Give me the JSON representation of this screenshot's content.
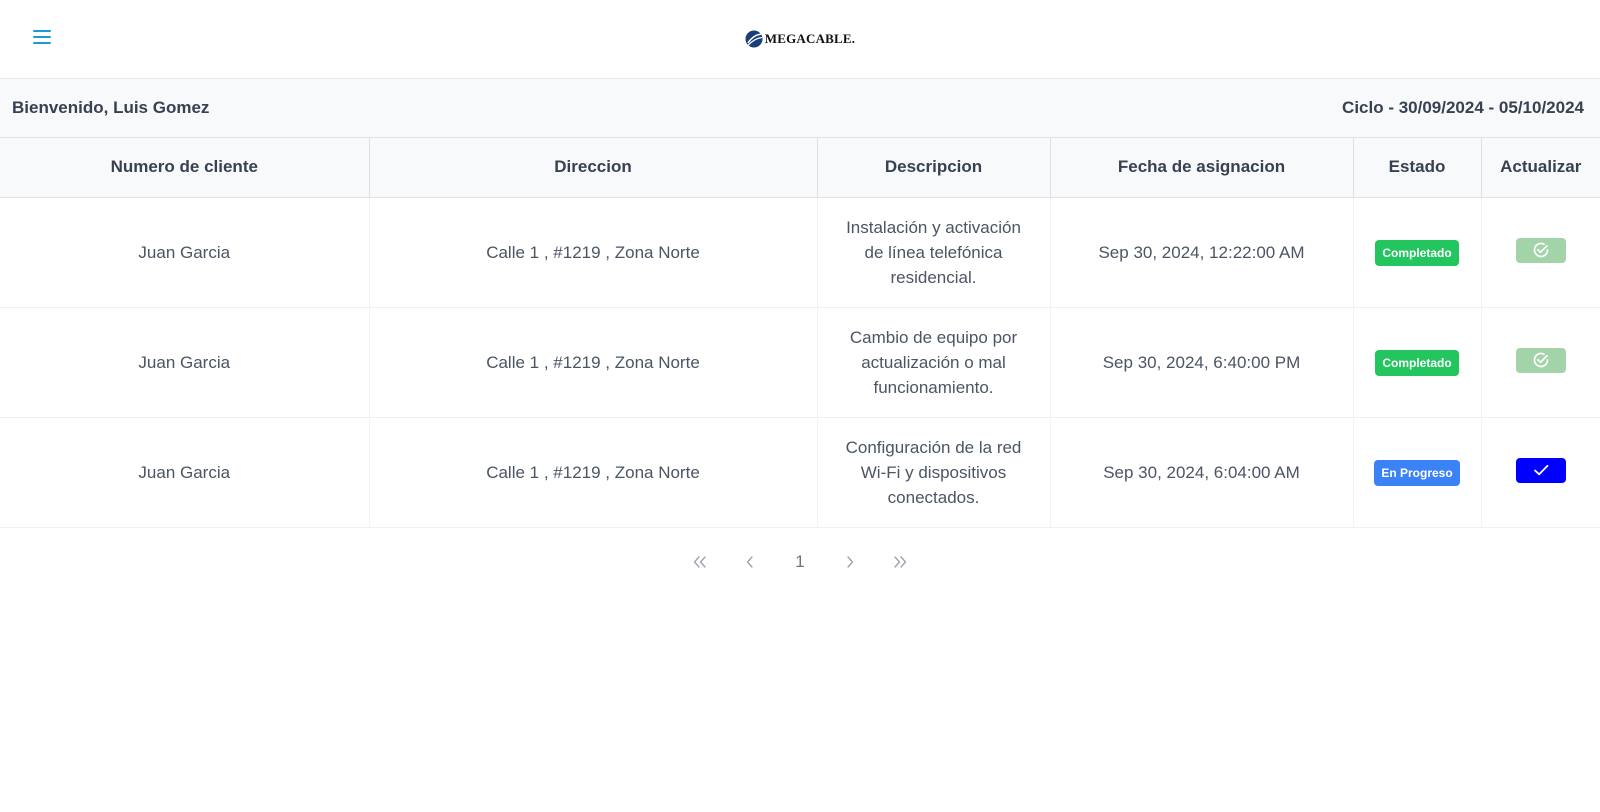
{
  "header": {
    "menu_icon": "hamburger-menu-icon",
    "logo_text": "MEGACABLE.",
    "accent_color": "#1c9bd6"
  },
  "welcome": {
    "greeting": "Bienvenido, Luis Gomez",
    "cycle": "Ciclo - 30/09/2024 - 05/10/2024"
  },
  "table": {
    "headers": [
      "Numero de cliente",
      "Direccion",
      "Descripcion",
      "Fecha de asignacion",
      "Estado",
      "Actualizar"
    ],
    "rows": [
      {
        "client": "Juan Garcia",
        "address": "Calle 1 , #1219 , Zona Norte",
        "description": "Instalación y activación de línea telefónica residencial.",
        "date": "Sep 30, 2024, 12:22:00 AM",
        "status": "Completado",
        "status_color": "#22c55e",
        "action_icon": "check-circle-icon",
        "action_enabled": false
      },
      {
        "client": "Juan Garcia",
        "address": "Calle 1 , #1219 , Zona Norte",
        "description": "Cambio de equipo por actualización o mal funcionamiento.",
        "date": "Sep 30, 2024, 6:40:00 PM",
        "status": "Completado",
        "status_color": "#22c55e",
        "action_icon": "check-circle-icon",
        "action_enabled": false
      },
      {
        "client": "Juan Garcia",
        "address": "Calle 1 , #1219 , Zona Norte",
        "description": "Configuración de la red Wi-Fi y dispositivos conectados.",
        "date": "Sep 30, 2024, 6:04:00 AM",
        "status": "En Progreso",
        "status_color": "#3b82f6",
        "action_icon": "checkmark-icon",
        "action_enabled": true
      }
    ]
  },
  "pagination": {
    "first_icon": "double-chevron-left-icon",
    "prev_icon": "chevron-left-icon",
    "current_page": "1",
    "next_icon": "chevron-right-icon",
    "last_icon": "double-chevron-right-icon"
  }
}
